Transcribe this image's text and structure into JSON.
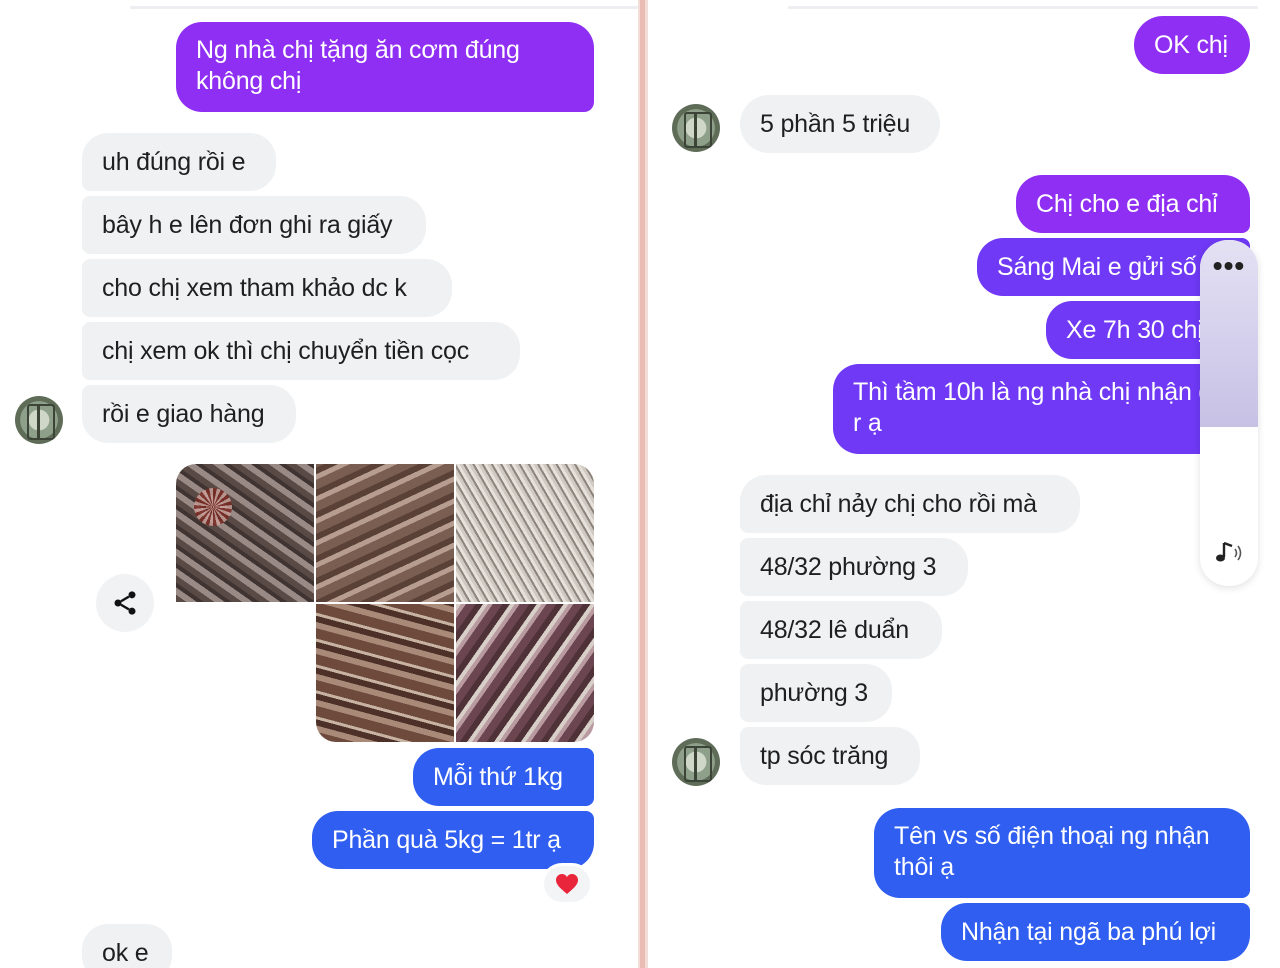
{
  "left_chat": {
    "messages": [
      {
        "text": "Ng nhà chị tặng ăn cơm đúng không chị",
        "sender": "me"
      },
      {
        "text": "uh đúng rồi e",
        "sender": "other"
      },
      {
        "text": "bây h e lên đơn ghi ra giấy",
        "sender": "other"
      },
      {
        "text": "cho chị xem tham khảo dc k",
        "sender": "other"
      },
      {
        "text": "chị xem ok thì chị chuyển tiền cọc",
        "sender": "other"
      },
      {
        "text": "rồi e giao hàng",
        "sender": "other"
      },
      {
        "text": "Mỗi thứ 1kg",
        "sender": "me"
      },
      {
        "text": "Phần quà 5kg = 1tr ạ",
        "sender": "me"
      },
      {
        "text": "ok e",
        "sender": "other"
      }
    ],
    "photo_count": 5,
    "reaction": "heart-icon"
  },
  "right_chat": {
    "messages": [
      {
        "text": "OK chị",
        "sender": "me"
      },
      {
        "text": "5 phần 5 triệu",
        "sender": "other"
      },
      {
        "text": "Chị cho e địa chỉ",
        "sender": "me"
      },
      {
        "text": "Sáng Mai e gửi số",
        "sender": "me"
      },
      {
        "text": "Xe 7h 30 chị",
        "sender": "me"
      },
      {
        "text": "Thì tầm 10h là ng nhà chị nhận dc r ạ",
        "sender": "me"
      },
      {
        "text": "địa chỉ nảy chị cho rồi mà",
        "sender": "other"
      },
      {
        "text": "48/32 phường 3",
        "sender": "other"
      },
      {
        "text": "48/32 lê duẩn",
        "sender": "other"
      },
      {
        "text": "phường 3",
        "sender": "other"
      },
      {
        "text": "tp sóc trăng",
        "sender": "other"
      },
      {
        "text": "Tên vs số điện thoại ng nhận thôi ạ",
        "sender": "me"
      },
      {
        "text": "Nhận tại ngã ba phú lợi",
        "sender": "me"
      }
    ]
  },
  "volume_control": {
    "more_label": "•••",
    "level_percent": 54,
    "icon": "volume-icon"
  },
  "colors": {
    "incoming_bubble": "#eff1f3",
    "outgoing_purple": "#8f2ff3",
    "outgoing_violet": "#6f39f5",
    "outgoing_blue": "#2f5ef0",
    "reaction_heart": "#e8253a"
  }
}
